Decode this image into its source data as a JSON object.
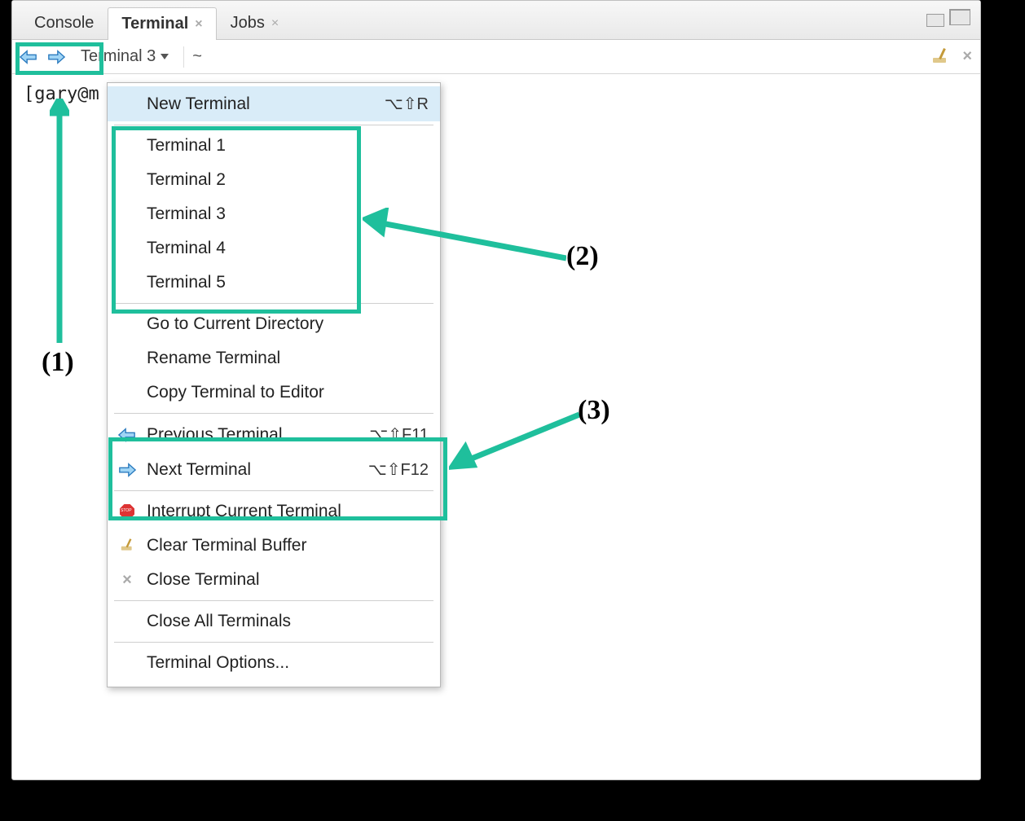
{
  "tabs": {
    "console": "Console",
    "terminal": "Terminal",
    "jobs": "Jobs"
  },
  "toolbar": {
    "terminal_name": "Terminal 3",
    "cwd": "~"
  },
  "prompt": "[gary@m",
  "menu": {
    "new_terminal": "New Terminal",
    "new_terminal_shortcut": "⌥⇧R",
    "terminals": [
      "Terminal 1",
      "Terminal 2",
      "Terminal 3",
      "Terminal 4",
      "Terminal 5"
    ],
    "go_current_dir": "Go to Current Directory",
    "rename": "Rename Terminal",
    "copy_to_editor": "Copy Terminal to Editor",
    "previous": "Previous Terminal",
    "previous_shortcut": "⌥⇧F11",
    "next": "Next Terminal",
    "next_shortcut": "⌥⇧F12",
    "interrupt": "Interrupt Current Terminal",
    "clear_buffer": "Clear Terminal Buffer",
    "close": "Close Terminal",
    "close_all": "Close All Terminals",
    "options": "Terminal Options..."
  },
  "annotations": {
    "a1": "(1)",
    "a2": "(2)",
    "a3": "(3)"
  }
}
